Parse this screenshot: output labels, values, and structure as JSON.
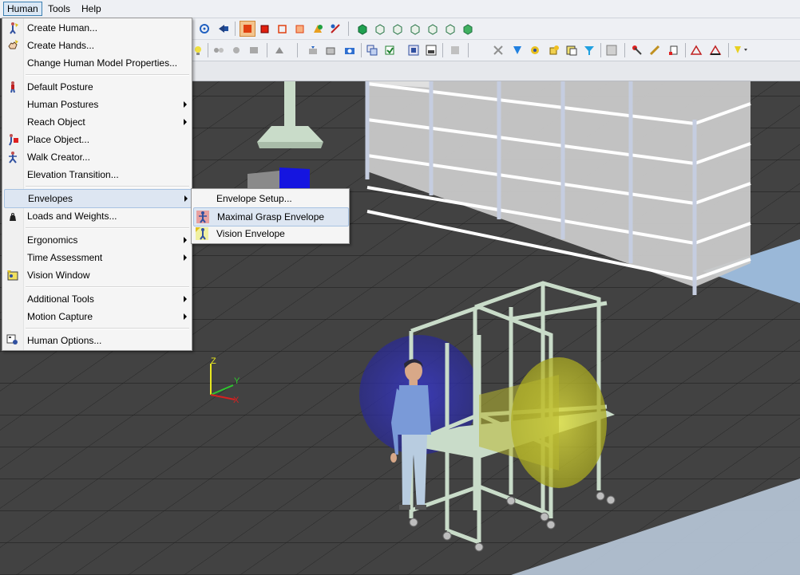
{
  "menubar": {
    "items": [
      {
        "label": "Human",
        "active": true
      },
      {
        "label": "Tools",
        "active": false
      },
      {
        "label": "Help",
        "active": false
      }
    ]
  },
  "human_menu": {
    "items": [
      {
        "label": "Create Human...",
        "icon": "create-human-icon",
        "submenu": false
      },
      {
        "label": "Create Hands...",
        "icon": "create-hands-icon",
        "submenu": false
      },
      {
        "label": "Change Human Model Properties...",
        "icon": "",
        "submenu": false
      },
      {
        "label": "Default Posture",
        "icon": "default-posture-icon",
        "submenu": false
      },
      {
        "label": "Human Postures",
        "icon": "",
        "submenu": true
      },
      {
        "label": "Reach Object",
        "icon": "",
        "submenu": true
      },
      {
        "label": "Place Object...",
        "icon": "place-object-icon",
        "submenu": false
      },
      {
        "label": "Walk Creator...",
        "icon": "walk-creator-icon",
        "submenu": false
      },
      {
        "label": "Elevation Transition...",
        "icon": "",
        "submenu": false
      },
      {
        "label": "Envelopes",
        "icon": "",
        "submenu": true,
        "highlighted": true
      },
      {
        "label": "Loads and Weights...",
        "icon": "weight-icon",
        "submenu": false
      },
      {
        "label": "Ergonomics",
        "icon": "",
        "submenu": true
      },
      {
        "label": "Time Assessment",
        "icon": "",
        "submenu": true
      },
      {
        "label": "Vision Window",
        "icon": "vision-window-icon",
        "submenu": false
      },
      {
        "label": "Additional Tools",
        "icon": "",
        "submenu": true
      },
      {
        "label": "Motion Capture",
        "icon": "",
        "submenu": true
      },
      {
        "label": "Human Options...",
        "icon": "human-options-icon",
        "submenu": false
      }
    ]
  },
  "envelopes_submenu": {
    "items": [
      {
        "label": "Envelope Setup...",
        "icon": "",
        "highlighted": false
      },
      {
        "label": "Maximal Grasp Envelope",
        "icon": "grasp-envelope-icon",
        "highlighted": true
      },
      {
        "label": "Vision Envelope",
        "icon": "vision-envelope-icon",
        "highlighted": false
      }
    ]
  },
  "axis_triad": {
    "x": "X",
    "y": "Y",
    "z": "Z"
  },
  "colors": {
    "floor": "#3f3f3f",
    "grid": "#1e1e1e",
    "shelf": "#c8c8c8",
    "cart": "#c9dcc9",
    "grasp_envelope": "#2f2fa8",
    "vision_envelope": "#c8c81e",
    "menu_highlight": "#dde6f2"
  }
}
